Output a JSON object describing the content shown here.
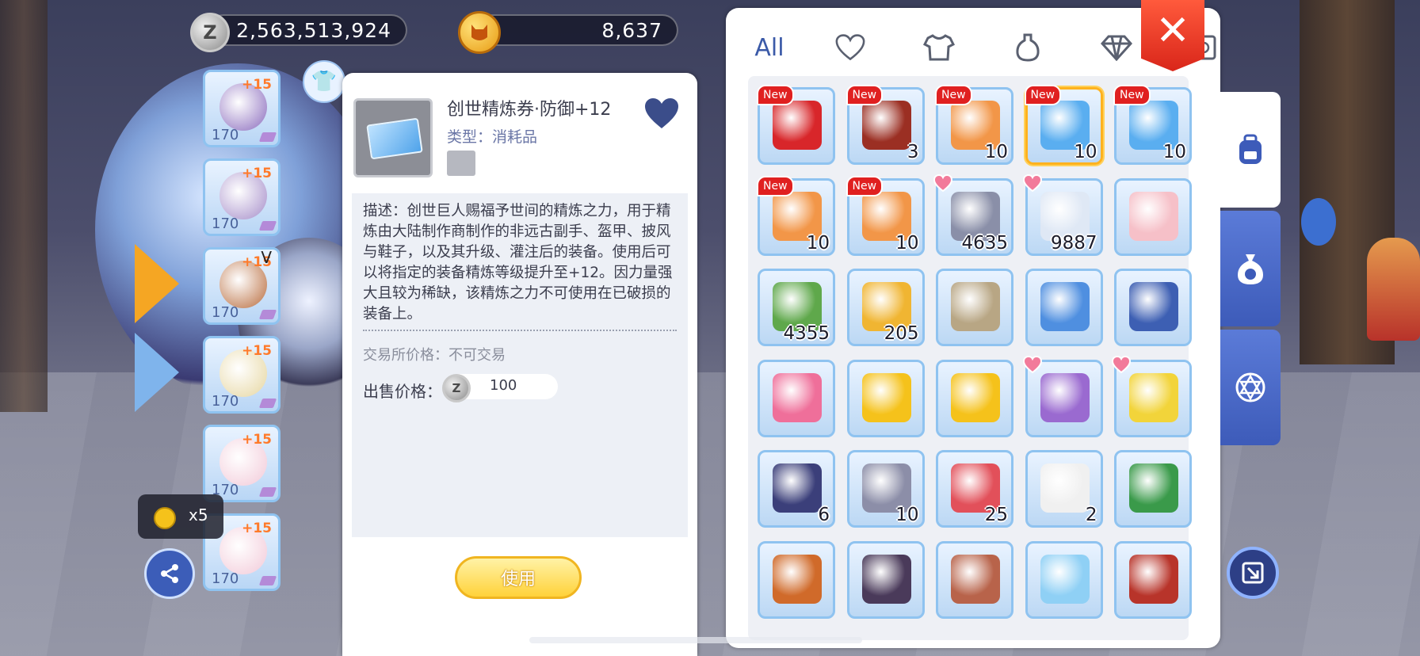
{
  "currencies": {
    "zeny": {
      "icon": "zeny-coin-icon",
      "symbol": "Z",
      "value": "2,563,513,924"
    },
    "cat_coin": {
      "icon": "cat-coin-icon",
      "value": "8,637"
    }
  },
  "equipment_slots": [
    {
      "name": "equip-slot-headgear",
      "plus": "+15",
      "level": "170",
      "color": "#8a6bbd"
    },
    {
      "name": "equip-slot-armor",
      "plus": "+15",
      "level": "170",
      "color": "#a58dc9"
    },
    {
      "name": "equip-slot-garment",
      "plus": "+15",
      "level": "170",
      "extra": "V",
      "color": "#b86b3c"
    },
    {
      "name": "equip-slot-shoes",
      "plus": "+15",
      "level": "170",
      "color": "#e6d6a0"
    },
    {
      "name": "equip-slot-accessory-1",
      "plus": "+15",
      "level": "170",
      "color": "#f2c9d8"
    },
    {
      "name": "equip-slot-accessory-2",
      "plus": "+15",
      "level": "170",
      "color": "#f2c9d8"
    }
  ],
  "coin_tooltip": {
    "text": "x5"
  },
  "detail": {
    "title": "创世精炼券·防御+12",
    "type": "类型：消耗品",
    "description": "描述：创世巨人赐福予世间的精炼之力，用于精炼由大陆制作商制作的非远古副手、盔甲、披风与鞋子，以及其升级、灌注后的装备。使用后可以将指定的装备精炼等级提升至+12。因力量强大且较为稀缺，该精炼之力不可使用在已破损的装备上。",
    "trade": "交易所价格：不可交易",
    "sell_label": "出售价格：",
    "sell_value": "100",
    "use_button": "使用"
  },
  "inventory": {
    "tabs": [
      {
        "name": "tab-all",
        "label": "All",
        "active": true
      },
      {
        "name": "tab-favorites",
        "icon": "heart-icon"
      },
      {
        "name": "tab-equipment",
        "icon": "shirt-icon"
      },
      {
        "name": "tab-consumables",
        "icon": "potion-icon"
      },
      {
        "name": "tab-gems",
        "icon": "diamond-icon"
      },
      {
        "name": "tab-cards",
        "icon": "card-icon"
      }
    ],
    "close_icon": "close-icon",
    "new_label": "New",
    "items": [
      {
        "icon": "red-envelope-icon",
        "count": "",
        "badge": "new",
        "color": "#d8262a"
      },
      {
        "icon": "chest-icon",
        "count": "3",
        "badge": "new",
        "color": "#9b2f23"
      },
      {
        "icon": "orange-ticket-icon",
        "count": "10",
        "badge": "new",
        "color": "#f29648"
      },
      {
        "icon": "blue-ticket-icon",
        "count": "10",
        "badge": "new",
        "color": "#5aaef0",
        "selected": true
      },
      {
        "icon": "blue-ticket-icon",
        "count": "10",
        "badge": "new",
        "color": "#5aaef0"
      },
      {
        "icon": "orange-ticket-icon",
        "count": "10",
        "badge": "new",
        "color": "#f29648"
      },
      {
        "icon": "orange-ticket-icon",
        "count": "10",
        "badge": "new",
        "color": "#f29648"
      },
      {
        "icon": "butterfly-wing-icon",
        "count": "4635",
        "badge": "fav",
        "color": "#8a8fa8"
      },
      {
        "icon": "fly-wing-icon",
        "count": "9887",
        "badge": "fav",
        "color": "#dfe8f5"
      },
      {
        "icon": "cake-icon",
        "count": "",
        "badge": "",
        "color": "#f6c0c8"
      },
      {
        "icon": "herb-icon",
        "count": "4355",
        "badge": "",
        "color": "#5fa84b"
      },
      {
        "icon": "golden-box-icon",
        "count": "205",
        "badge": "",
        "color": "#f0b532"
      },
      {
        "icon": "hammer-icon",
        "count": "",
        "badge": "",
        "color": "#b8a684"
      },
      {
        "icon": "crystal-ball-icon",
        "count": "",
        "badge": "",
        "color": "#4f8fe0"
      },
      {
        "icon": "gift-box-icon",
        "count": "",
        "badge": "",
        "color": "#3d5fb3"
      },
      {
        "icon": "pink-scroll-icon",
        "count": "",
        "badge": "",
        "color": "#ef6f9a"
      },
      {
        "icon": "gold-star-coin-icon",
        "count": "",
        "badge": "",
        "color": "#f5c21b"
      },
      {
        "icon": "gold-question-coin-icon",
        "count": "",
        "badge": "",
        "color": "#f5c21b"
      },
      {
        "icon": "sale-card-icon",
        "count": "",
        "badge": "fav",
        "color": "#9a6ad0"
      },
      {
        "icon": "special-ticket-icon",
        "count": "",
        "badge": "fav",
        "color": "#f2d43a"
      },
      {
        "icon": "dark-chest-icon",
        "count": "6",
        "badge": "",
        "color": "#3b3f7a"
      },
      {
        "icon": "ore-icon",
        "count": "10",
        "badge": "",
        "color": "#8c8ea8"
      },
      {
        "icon": "red-box-icon",
        "count": "25",
        "badge": "",
        "color": "#e2505a"
      },
      {
        "icon": "first-aid-icon",
        "count": "2",
        "badge": "",
        "color": "#f0f0f0"
      },
      {
        "icon": "green-book-icon",
        "count": "",
        "badge": "",
        "color": "#3a9a4a"
      },
      {
        "icon": "pouch-icon",
        "count": "",
        "badge": "",
        "color": "#d06a2a"
      },
      {
        "icon": "dark-book-icon",
        "count": "",
        "badge": "",
        "color": "#4a3a5a"
      },
      {
        "icon": "paw-bag-icon",
        "count": "",
        "badge": "",
        "color": "#b8634a"
      },
      {
        "icon": "crystal-box-icon",
        "count": "",
        "badge": "",
        "color": "#8fd0f5"
      },
      {
        "icon": "red-book-icon",
        "count": "",
        "badge": "",
        "color": "#b8342a"
      }
    ]
  },
  "side_tabs": [
    {
      "name": "side-tab-backpack",
      "icon": "backpack-icon",
      "active": true
    },
    {
      "name": "side-tab-zeny-bag",
      "icon": "money-bag-icon",
      "active": false
    },
    {
      "name": "side-tab-magic-circle",
      "icon": "hexagram-icon",
      "active": false
    }
  ]
}
